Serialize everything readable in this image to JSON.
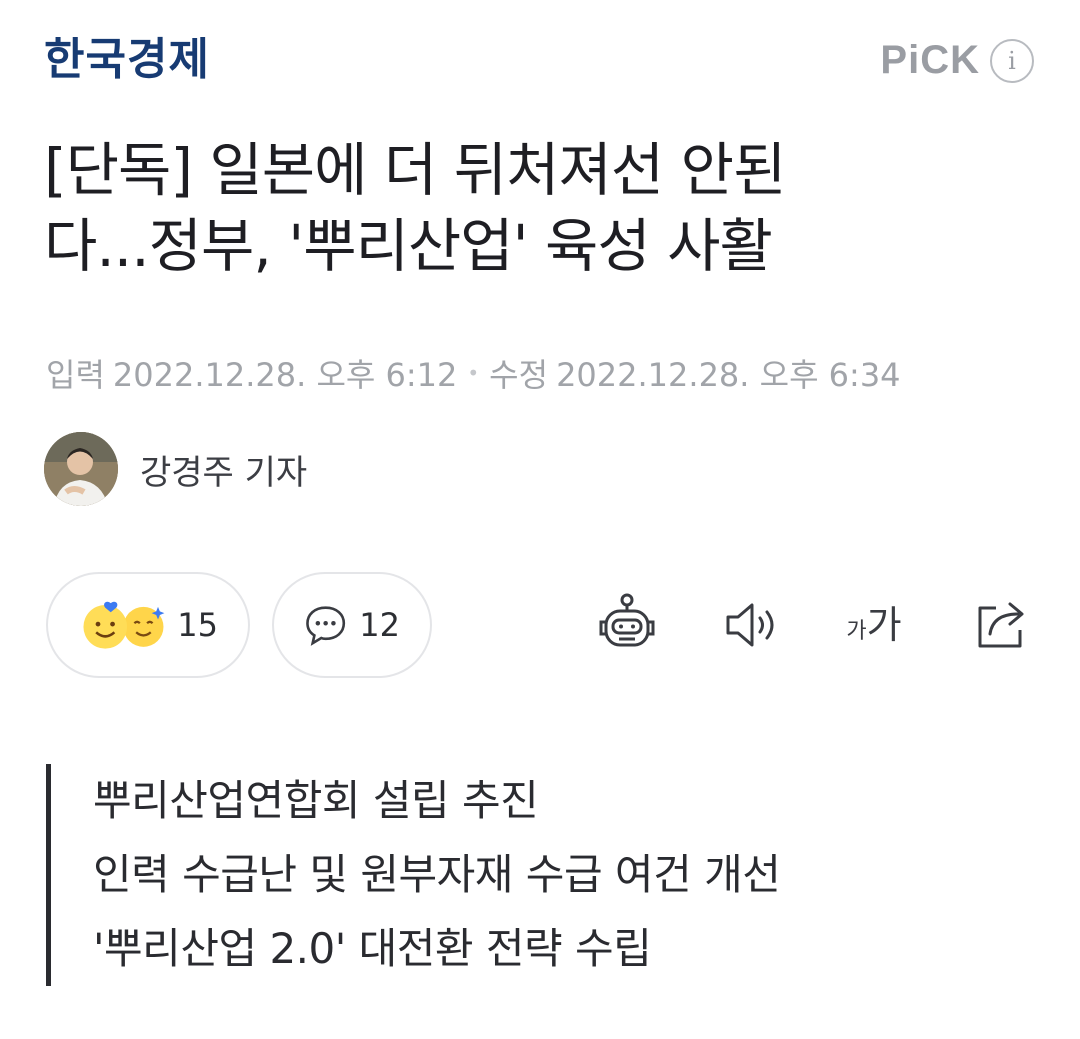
{
  "header": {
    "press_name": "한국경제",
    "pick_label": "PiCK",
    "info_icon": "i"
  },
  "article": {
    "headline_line1": "[단독] 일본에 더 뒤처져선 안된",
    "headline_line2": "다...정부, '뿌리산업' 육성 사활",
    "published_label": "입력",
    "published": "2022.12.28. 오후 6:12",
    "modified_label": "수정",
    "modified": "2022.12.28. 오후 6:34",
    "author": "강경주 기자"
  },
  "actions": {
    "reaction_count": "15",
    "comment_count": "12",
    "tools": [
      "robot-summary-icon",
      "speaker-icon",
      "font-size-icon",
      "share-icon"
    ],
    "font_size_small": "가",
    "font_size_large": "가"
  },
  "summary": [
    "뿌리산업연합회 설립 추진",
    "인력 수급난 및 원부자재 수급 여건 개선",
    "'뿌리산업 2.0' 대전환 전략 수립"
  ],
  "colors": {
    "press_logo": "#173b73",
    "meta_text": "#a1a4a9",
    "text": "#1e1e23"
  }
}
